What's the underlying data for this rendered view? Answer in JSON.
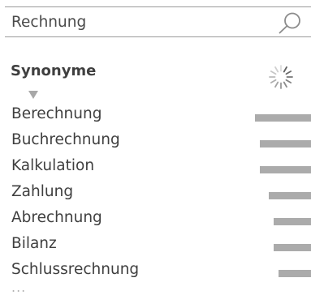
{
  "search": {
    "value": "Rechnung"
  },
  "section": {
    "heading": "Synonyme"
  },
  "icons": {
    "search": "search-icon",
    "toggle": "triangle-down-icon",
    "loading": "spinner-icon"
  },
  "colors": {
    "text": "#3f3f3f",
    "border": "#9a9a9a",
    "bar": "#ababab",
    "muted": "#b3b3b3"
  },
  "results": [
    {
      "label": "Berechnung",
      "relevance": 0.18
    },
    {
      "label": "Buchrechnung",
      "relevance": 0.165
    },
    {
      "label": "Kalkulation",
      "relevance": 0.165
    },
    {
      "label": "Zahlung",
      "relevance": 0.135
    },
    {
      "label": "Abrechnung",
      "relevance": 0.12
    },
    {
      "label": "Bilanz",
      "relevance": 0.12
    },
    {
      "label": "Schlussrechnung",
      "relevance": 0.105
    }
  ],
  "more": {
    "label": "..."
  }
}
